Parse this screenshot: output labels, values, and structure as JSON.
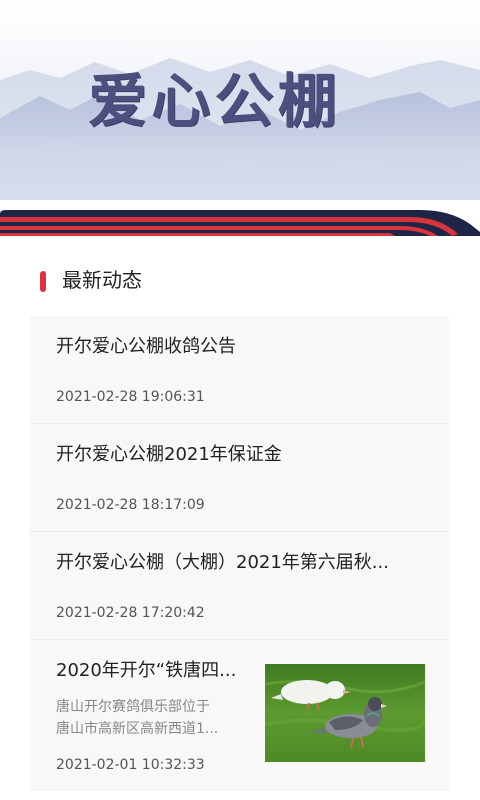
{
  "banner": {
    "title": "爱心公棚"
  },
  "section": {
    "title": "最新动态"
  },
  "news": [
    {
      "title": "开尔爱心公棚收鸽公告",
      "time": "2021-02-28 19:06:31"
    },
    {
      "title": "开尔爱心公棚2021年保证金",
      "time": "2021-02-28 18:17:09"
    },
    {
      "title": "开尔爱心公棚（大棚）2021年第六届秋...",
      "time": "2021-02-28 17:20:42"
    },
    {
      "title": "2020年开尔“铁唐四...",
      "excerpt_line1": "唐山开尔赛鸽俱乐部位于",
      "excerpt_line2": "唐山市高新区高新西道1...",
      "time": "2021-02-01 10:32:33",
      "image": "pigeons-on-grass-photo"
    }
  ],
  "colors": {
    "accent": "#e0313b",
    "title_text": "#4d4f7e",
    "banner_band_dark": "#1f2547",
    "banner_band_red": "#d8343c"
  }
}
